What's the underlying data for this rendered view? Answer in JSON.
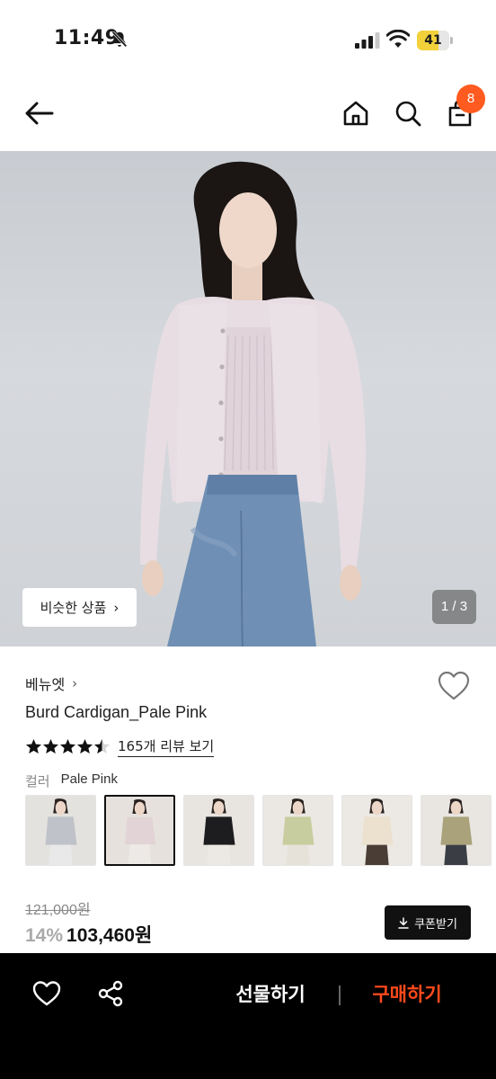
{
  "status_bar": {
    "time": "11:49",
    "battery": "41",
    "icons": [
      "bell-slash-icon",
      "signal-icon",
      "wifi-icon",
      "battery-icon"
    ]
  },
  "top_nav": {
    "icons": [
      "back-arrow-icon",
      "home-icon",
      "search-icon",
      "shopping-bag-icon"
    ],
    "cart_count": "8"
  },
  "hero": {
    "similar_label": "비슷한 상품",
    "page_indicator": "1 / 3"
  },
  "product": {
    "brand": "베뉴엣",
    "name": "Burd Cardigan_Pale Pink",
    "rating": 4.5,
    "review_link": "165개 리뷰 보기",
    "color_label": "컬러",
    "color_value": "Pale Pink",
    "original_price": "121,000원",
    "discount": "14%",
    "price": "103,460원",
    "coupon_label": "쿠폰받기"
  },
  "thumbnails": [
    {
      "color": "light-gray",
      "selected": false
    },
    {
      "color": "pale-pink",
      "selected": true
    },
    {
      "color": "black",
      "selected": false
    },
    {
      "color": "light-olive",
      "selected": false
    },
    {
      "color": "cream",
      "selected": false
    },
    {
      "color": "khaki",
      "selected": false
    }
  ],
  "bottom_bar": {
    "gift_label": "선물하기",
    "buy_label": "구매하기"
  },
  "colors": {
    "accent_orange": "#ff5a1f",
    "buy_red": "#ff4a1c",
    "bottom_bar_bg": "#000000"
  }
}
